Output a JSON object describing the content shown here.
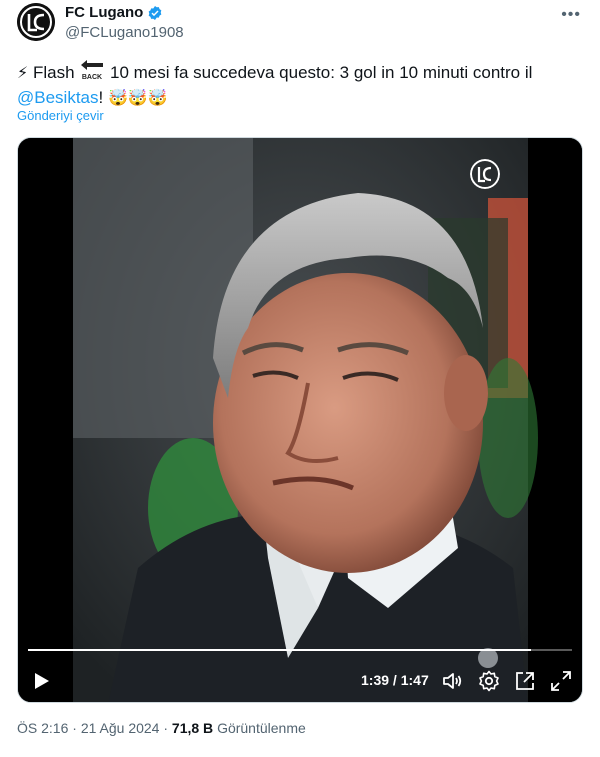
{
  "account": {
    "display_name": "FC Lugano",
    "handle": "@FCLugano1908",
    "verified_color": "#1d9bf0",
    "more_label": "•••"
  },
  "tweet": {
    "emoji_lightning": "⚡",
    "word_flash": "Flash",
    "back_icon": "back-arrow-icon",
    "text_main": "10 mesi fa succedeva questo: 3 gol in 10 minuti contro il",
    "mention": "@Besiktas",
    "text_after_mention": "!",
    "trailing_emojis": "🤯🤯🤯"
  },
  "translate_label": "Gönderiyi çevir",
  "video": {
    "current_time": "1:39",
    "separator": "/",
    "duration": "1:47",
    "progress_fraction": 0.925,
    "controls": [
      "play-icon",
      "volume-icon",
      "settings-icon",
      "pop-out-icon",
      "fullscreen-icon"
    ]
  },
  "meta": {
    "time": "ÖS 2:16",
    "dot": "·",
    "date": "21 Ağu 2024",
    "views_count": "71,8 B",
    "views_label": "Görüntülenme"
  },
  "colors": {
    "accent": "#1d9bf0",
    "text": "#0f1419",
    "muted": "#536471"
  }
}
